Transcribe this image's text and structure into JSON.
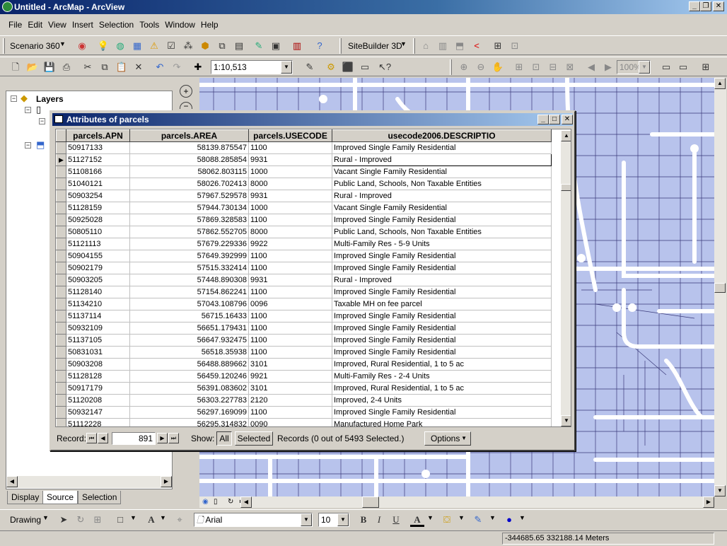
{
  "app": {
    "title": "Untitled - ArcMap - ArcView"
  },
  "menu": [
    "File",
    "Edit",
    "View",
    "Insert",
    "Selection",
    "Tools",
    "Window",
    "Help"
  ],
  "toolbar1": {
    "scenario": "Scenario 360",
    "sitebuilder": "SiteBuilder 3D"
  },
  "toolbar2": {
    "scale": "1:10,513",
    "zoom": "100%"
  },
  "toc": {
    "root": "Layers",
    "tabs": [
      "Display",
      "Source",
      "Selection"
    ]
  },
  "attr_window": {
    "title": "Attributes of parcels",
    "columns": [
      "parcels.APN",
      "parcels.AREA",
      "parcels.USECODE",
      "usecode2006.DESCRIPTIO"
    ],
    "rows": [
      [
        "50917133",
        "58139.875547",
        "1100",
        "Improved Single Family Residential"
      ],
      [
        "51127152",
        "58088.285854",
        "9931",
        "Rural - Improved"
      ],
      [
        "51108166",
        "58062.803115",
        "1000",
        "Vacant Single Family Residential"
      ],
      [
        "51040121",
        "58026.702413",
        "8000",
        "Public Land, Schools, Non Taxable Entities"
      ],
      [
        "50903254",
        "57967.529578",
        "9931",
        "Rural - Improved"
      ],
      [
        "51128159",
        "57944.730134",
        "1000",
        "Vacant Single Family Residential"
      ],
      [
        "50925028",
        "57869.328583",
        "1100",
        "Improved Single Family Residential"
      ],
      [
        "50805110",
        "57862.552705",
        "8000",
        "Public Land, Schools, Non Taxable Entities"
      ],
      [
        "51121113",
        "57679.229336",
        "9922",
        "Multi-Family Res - 5-9 Units"
      ],
      [
        "50904155",
        "57649.392999",
        "1100",
        "Improved Single Family Residential"
      ],
      [
        "50902179",
        "57515.332414",
        "1100",
        "Improved Single Family Residential"
      ],
      [
        "50903205",
        "57448.890308",
        "9931",
        "Rural - Improved"
      ],
      [
        "51128140",
        "57154.862241",
        "1100",
        "Improved Single Family Residential"
      ],
      [
        "51134210",
        "57043.108796",
        "0096",
        "Taxable MH on fee parcel"
      ],
      [
        "51137114",
        "56715.16433",
        "1100",
        "Improved Single Family Residential"
      ],
      [
        "50932109",
        "56651.179431",
        "1100",
        "Improved Single Family Residential"
      ],
      [
        "51137105",
        "56647.932475",
        "1100",
        "Improved Single Family Residential"
      ],
      [
        "50831031",
        "56518.35938",
        "1100",
        "Improved Single Family Residential"
      ],
      [
        "50903208",
        "56488.889662",
        "3101",
        "Improved, Rural Residential, 1 to 5 ac"
      ],
      [
        "51128128",
        "56459.120246",
        "9921",
        "Multi-Family Res - 2-4 Units"
      ],
      [
        "50917179",
        "56391.083602",
        "3101",
        "Improved, Rural Residential, 1 to 5 ac"
      ],
      [
        "51120208",
        "56303.227783",
        "2120",
        "Improved, 2-4 Units"
      ],
      [
        "50932147",
        "56297.169099",
        "1100",
        "Improved Single Family Residential"
      ],
      [
        "51112228",
        "56295.314832",
        "0090",
        "Manufactured Home Park"
      ]
    ],
    "footer": {
      "record_label": "Record:",
      "record_value": "891",
      "show_label": "Show:",
      "all": "All",
      "selected": "Selected",
      "records_text": "Records (0 out of 5493 Selected.)",
      "options": "Options"
    }
  },
  "drawing": {
    "label": "Drawing",
    "font": "Arial",
    "size": "10",
    "bold": "B",
    "italic": "I",
    "underline": "U"
  },
  "status": {
    "coords": "-344685.65  332188.14 Meters"
  },
  "colors": {
    "map_bg": "#b8c3ec",
    "titlebar": "#0a246a"
  }
}
